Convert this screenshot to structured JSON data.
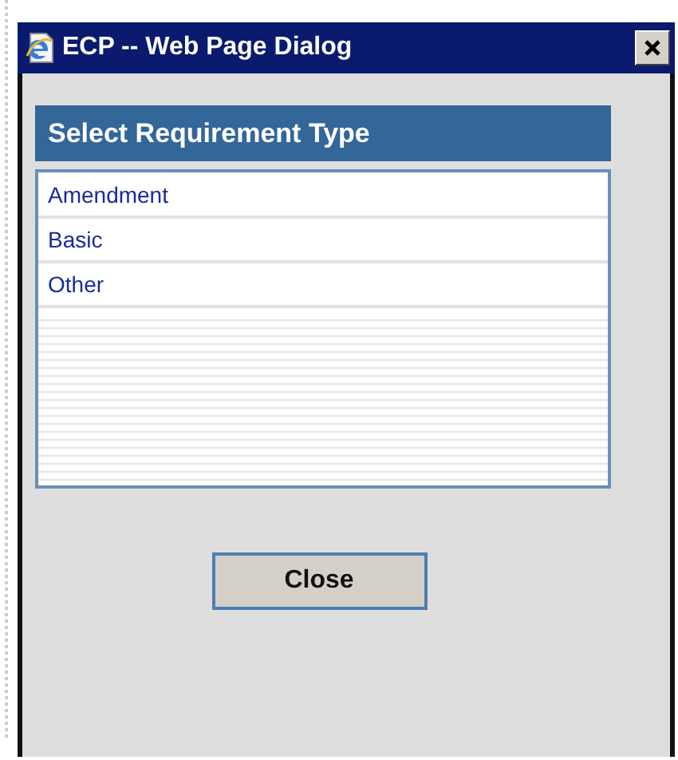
{
  "window": {
    "title": "ECP -- Web Page Dialog"
  },
  "panel": {
    "heading": "Select Requirement Type",
    "items": [
      {
        "label": "Amendment"
      },
      {
        "label": "Basic"
      },
      {
        "label": "Other"
      }
    ]
  },
  "buttons": [
    "Close"
  ]
}
